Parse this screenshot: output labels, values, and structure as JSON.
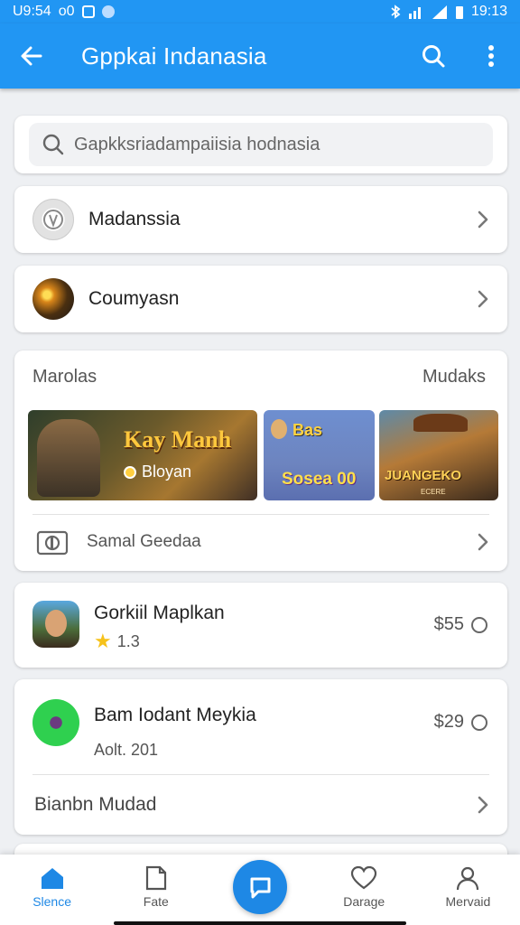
{
  "status_bar": {
    "left_text": "U9:54",
    "left_extra": "o0",
    "time": "19:13"
  },
  "app_bar": {
    "title": "Gppkai Indanasia",
    "back_icon": "arrow-left-icon",
    "search_icon": "search-icon",
    "more_icon": "more-vertical-icon"
  },
  "search": {
    "placeholder": "Gapkksriadampaiisia hodnasia"
  },
  "rows": [
    {
      "label": "Madanssia"
    },
    {
      "label": "Coumyasn"
    }
  ],
  "section": {
    "title": "Marolas",
    "more_label": "Mudaks",
    "banners": [
      {
        "headline": "Kay Manh",
        "sub": "Bloyan"
      },
      {
        "top": "Bas",
        "bottom": "Sosea 00"
      },
      {
        "title": "JUANGEKO",
        "tag": "ECERE"
      }
    ],
    "footer_label": "Samal Geedaa"
  },
  "apps": [
    {
      "name": "Gorkiil Maplkan",
      "rating": "1.3",
      "price": "$55"
    },
    {
      "name": "Bam Iodant Meykia",
      "sub": "Aolt. 201",
      "price": "$29",
      "footer_label": "Bianbn Mudad"
    }
  ],
  "bottom_nav": [
    {
      "label": "Slence",
      "icon": "home-icon",
      "active": true
    },
    {
      "label": "Fate",
      "icon": "document-icon"
    },
    {
      "label": "",
      "icon": "chat-icon"
    },
    {
      "label": "Darage",
      "icon": "heart-icon"
    },
    {
      "label": "Mervaid",
      "icon": "person-icon"
    }
  ],
  "colors": {
    "primary": "#2196f3",
    "nav_active": "#1e88e5",
    "star": "#f6c21b"
  }
}
